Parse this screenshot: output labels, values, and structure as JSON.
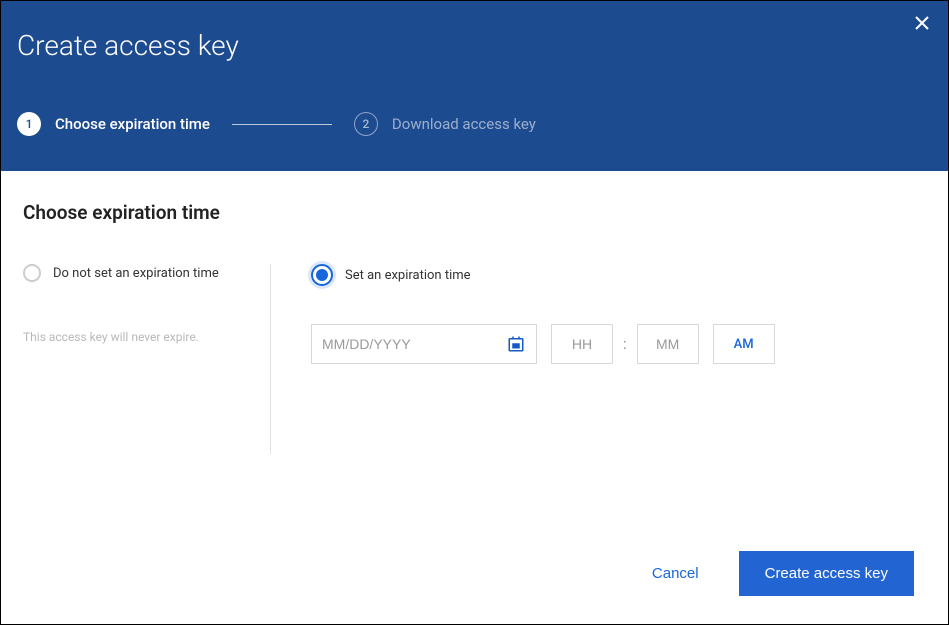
{
  "modal": {
    "title": "Create access key"
  },
  "stepper": {
    "steps": [
      {
        "num": "1",
        "label": "Choose expiration time",
        "active": true
      },
      {
        "num": "2",
        "label": "Download access key",
        "active": false
      }
    ]
  },
  "section": {
    "title": "Choose expiration time"
  },
  "options": {
    "no_expire": {
      "label": "Do not set an expiration time",
      "hint": "This access key will never expire.",
      "selected": false
    },
    "set_expire": {
      "label": "Set an expiration time",
      "selected": true,
      "date_placeholder": "MM/DD/YYYY",
      "hh_placeholder": "HH",
      "mm_placeholder": "MM",
      "colon": ":",
      "ampm": "AM"
    }
  },
  "footer": {
    "cancel_label": "Cancel",
    "submit_label": "Create access key"
  }
}
